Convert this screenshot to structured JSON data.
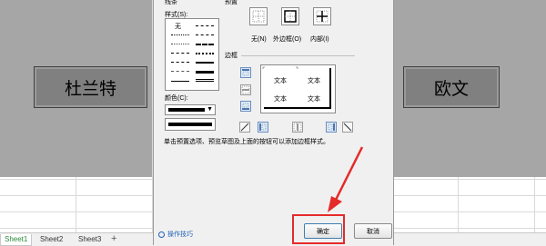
{
  "spreadsheet": {
    "cells": {
      "left_text": "杜兰特",
      "right_text": "欧文"
    },
    "sheets": [
      "Sheet1",
      "Sheet2",
      "Sheet3"
    ],
    "add_sheet_label": "+"
  },
  "dialog": {
    "line_group_label": "线条",
    "style_label": "样式(S):",
    "style_none": "无",
    "color_label": "颜色(C):",
    "preset_group_label": "预置",
    "presets": [
      {
        "label": "无(N)",
        "icon": "preset-none-icon"
      },
      {
        "label": "外边框(O)",
        "icon": "preset-outline-icon"
      },
      {
        "label": "内部(I)",
        "icon": "preset-inside-icon"
      }
    ],
    "border_group_label": "边框",
    "preview_text": [
      "文本",
      "文本",
      "文本",
      "文本"
    ],
    "hint": "单击预置选项、预览草图及上面的按钮可以添加边框样式。",
    "tips_link": "操作技巧",
    "ok_label": "确定",
    "cancel_label": "取消"
  },
  "colors": {
    "highlight": "#e52a2a",
    "sheet_active_tab": "#2a8a3a",
    "cell_fill": "#808080",
    "band_fill": "#a6a6a6"
  }
}
